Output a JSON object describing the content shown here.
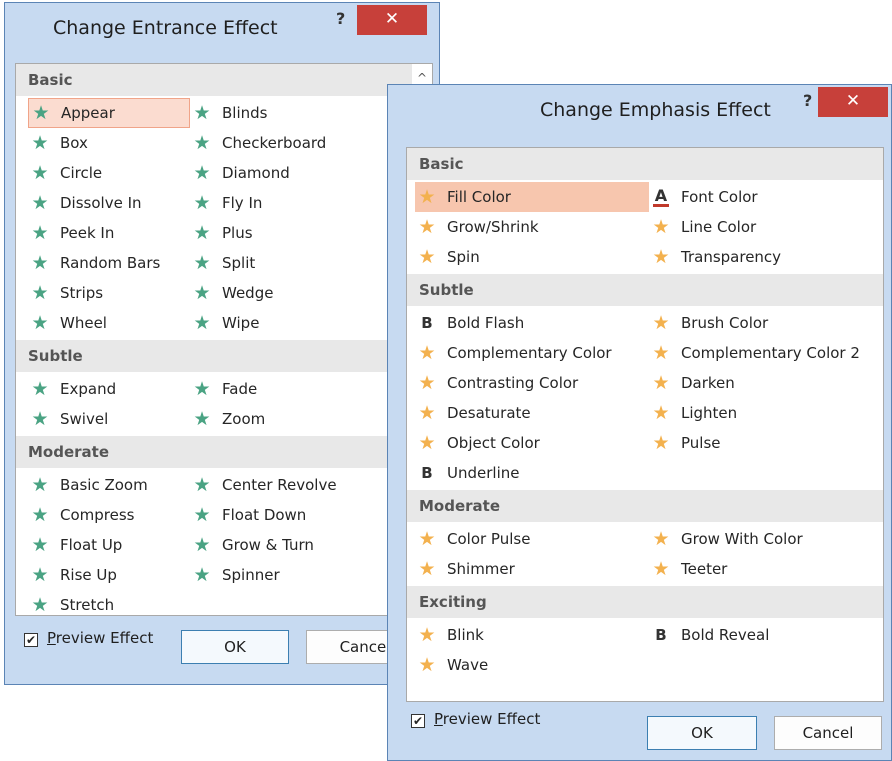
{
  "entrance": {
    "title": "Change Entrance Effect",
    "help": "?",
    "close": "✕",
    "categories": [
      {
        "name": "Basic",
        "items": [
          {
            "label": "Appear",
            "icon": "green-star-icon",
            "selected": true
          },
          {
            "label": "Blinds",
            "icon": "green-star-icon"
          },
          {
            "label": "Box",
            "icon": "green-star-icon"
          },
          {
            "label": "Checkerboard",
            "icon": "green-star-icon"
          },
          {
            "label": "Circle",
            "icon": "green-star-icon"
          },
          {
            "label": "Diamond",
            "icon": "green-star-icon"
          },
          {
            "label": "Dissolve In",
            "icon": "green-star-icon"
          },
          {
            "label": "Fly In",
            "icon": "green-star-icon"
          },
          {
            "label": "Peek In",
            "icon": "green-star-icon"
          },
          {
            "label": "Plus",
            "icon": "green-star-icon"
          },
          {
            "label": "Random Bars",
            "icon": "green-star-icon"
          },
          {
            "label": "Split",
            "icon": "green-star-icon"
          },
          {
            "label": "Strips",
            "icon": "green-star-icon"
          },
          {
            "label": "Wedge",
            "icon": "green-star-icon"
          },
          {
            "label": "Wheel",
            "icon": "green-star-icon"
          },
          {
            "label": "Wipe",
            "icon": "green-star-icon"
          }
        ]
      },
      {
        "name": "Subtle",
        "items": [
          {
            "label": "Expand",
            "icon": "green-star-icon"
          },
          {
            "label": "Fade",
            "icon": "green-star-icon"
          },
          {
            "label": "Swivel",
            "icon": "green-star-icon"
          },
          {
            "label": "Zoom",
            "icon": "green-star-icon"
          }
        ]
      },
      {
        "name": "Moderate",
        "items": [
          {
            "label": "Basic Zoom",
            "icon": "green-star-icon"
          },
          {
            "label": "Center Revolve",
            "icon": "green-star-icon"
          },
          {
            "label": "Compress",
            "icon": "green-star-icon"
          },
          {
            "label": "Float Down",
            "icon": "green-star-icon"
          },
          {
            "label": "Float Up",
            "icon": "green-star-icon"
          },
          {
            "label": "Grow & Turn",
            "icon": "green-star-icon"
          },
          {
            "label": "Rise Up",
            "icon": "green-star-icon"
          },
          {
            "label": "Spinner",
            "icon": "green-star-icon"
          },
          {
            "label": "Stretch",
            "icon": "green-star-icon"
          }
        ]
      }
    ],
    "preview_prefix": "P",
    "preview_rest": "review Effect",
    "preview_checked": true,
    "ok": "OK",
    "cancel": "Cancel"
  },
  "emphasis": {
    "title": "Change Emphasis Effect",
    "help": "?",
    "close": "✕",
    "categories": [
      {
        "name": "Basic",
        "items": [
          {
            "label": "Fill Color",
            "icon": "orange-star-icon",
            "selected": true
          },
          {
            "label": "Font Color",
            "icon": "font-color-a-icon"
          },
          {
            "label": "Grow/Shrink",
            "icon": "orange-star-icon"
          },
          {
            "label": "Line Color",
            "icon": "orange-star-icon"
          },
          {
            "label": "Spin",
            "icon": "orange-star-icon"
          },
          {
            "label": "Transparency",
            "icon": "orange-star-icon"
          }
        ]
      },
      {
        "name": "Subtle",
        "items": [
          {
            "label": "Bold Flash",
            "icon": "bold-b-icon"
          },
          {
            "label": "Brush Color",
            "icon": "orange-star-icon"
          },
          {
            "label": "Complementary Color",
            "icon": "orange-star-icon"
          },
          {
            "label": "Complementary Color 2",
            "icon": "orange-star-icon"
          },
          {
            "label": "Contrasting Color",
            "icon": "orange-star-icon"
          },
          {
            "label": "Darken",
            "icon": "orange-star-icon"
          },
          {
            "label": "Desaturate",
            "icon": "orange-star-icon"
          },
          {
            "label": "Lighten",
            "icon": "orange-star-icon"
          },
          {
            "label": "Object Color",
            "icon": "orange-star-icon"
          },
          {
            "label": "Pulse",
            "icon": "orange-star-icon"
          },
          {
            "label": "Underline",
            "icon": "bold-b-icon"
          }
        ]
      },
      {
        "name": "Moderate",
        "items": [
          {
            "label": "Color Pulse",
            "icon": "orange-star-icon"
          },
          {
            "label": "Grow With Color",
            "icon": "orange-star-icon"
          },
          {
            "label": "Shimmer",
            "icon": "orange-star-icon"
          },
          {
            "label": "Teeter",
            "icon": "orange-star-icon"
          }
        ]
      },
      {
        "name": "Exciting",
        "items": [
          {
            "label": "Blink",
            "icon": "orange-star-icon"
          },
          {
            "label": "Bold Reveal",
            "icon": "bold-b-icon"
          },
          {
            "label": "Wave",
            "icon": "orange-star-icon"
          }
        ]
      }
    ],
    "preview_prefix": "P",
    "preview_rest": "review Effect",
    "preview_checked": true,
    "ok": "OK",
    "cancel": "Cancel"
  },
  "colors": {
    "green_star": "#4aa383",
    "orange_star": "#f3b14e",
    "close_button": "#c7403a",
    "dialog_frame": "#c7daf1"
  }
}
